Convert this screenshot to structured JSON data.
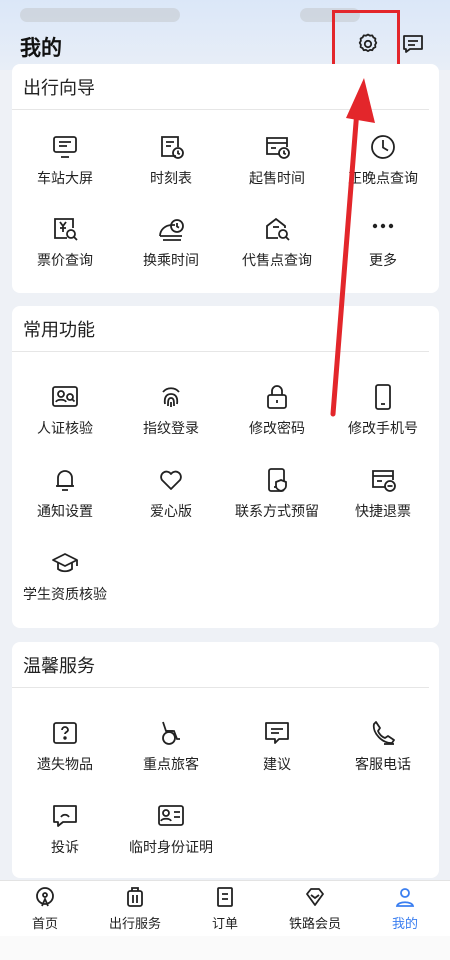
{
  "header": {
    "title": "我的"
  },
  "sections": [
    {
      "title": "出行向导",
      "items": [
        {
          "label": "车站大屏",
          "icon": "screen-icon"
        },
        {
          "label": "时刻表",
          "icon": "timetable-icon"
        },
        {
          "label": "起售时间",
          "icon": "sale-time-icon"
        },
        {
          "label": "正晚点查询",
          "icon": "clock-icon"
        },
        {
          "label": "票价查询",
          "icon": "fare-icon"
        },
        {
          "label": "换乘时间",
          "icon": "transfer-icon"
        },
        {
          "label": "代售点查询",
          "icon": "agency-icon"
        },
        {
          "label": "更多",
          "icon": "more-icon"
        }
      ]
    },
    {
      "title": "常用功能",
      "items": [
        {
          "label": "人证核验",
          "icon": "id-verify-icon"
        },
        {
          "label": "指纹登录",
          "icon": "fingerprint-icon"
        },
        {
          "label": "修改密码",
          "icon": "lock-icon"
        },
        {
          "label": "修改手机号",
          "icon": "phone-icon"
        },
        {
          "label": "通知设置",
          "icon": "bell-icon"
        },
        {
          "label": "爱心版",
          "icon": "heart-icon"
        },
        {
          "label": "联系方式预留",
          "icon": "contact-icon"
        },
        {
          "label": "快捷退票",
          "icon": "refund-icon"
        },
        {
          "label": "学生资质核验",
          "icon": "graduation-cap-icon"
        }
      ]
    },
    {
      "title": "温馨服务",
      "items": [
        {
          "label": "遗失物品",
          "icon": "lost-item-icon"
        },
        {
          "label": "重点旅客",
          "icon": "wheelchair-icon"
        },
        {
          "label": "建议",
          "icon": "suggestion-icon"
        },
        {
          "label": "客服电话",
          "icon": "phone-call-icon"
        },
        {
          "label": "投诉",
          "icon": "complaint-icon"
        },
        {
          "label": "临时身份证明",
          "icon": "temp-id-icon"
        }
      ]
    }
  ],
  "tabs": [
    {
      "label": "首页",
      "icon": "home-icon"
    },
    {
      "label": "出行服务",
      "icon": "luggage-icon"
    },
    {
      "label": "订单",
      "icon": "order-icon"
    },
    {
      "label": "铁路会员",
      "icon": "diamond-icon"
    },
    {
      "label": "我的",
      "icon": "user-icon",
      "active": true
    }
  ],
  "colors": {
    "accent": "#3a7ef0",
    "highlight": "#e3262b"
  }
}
